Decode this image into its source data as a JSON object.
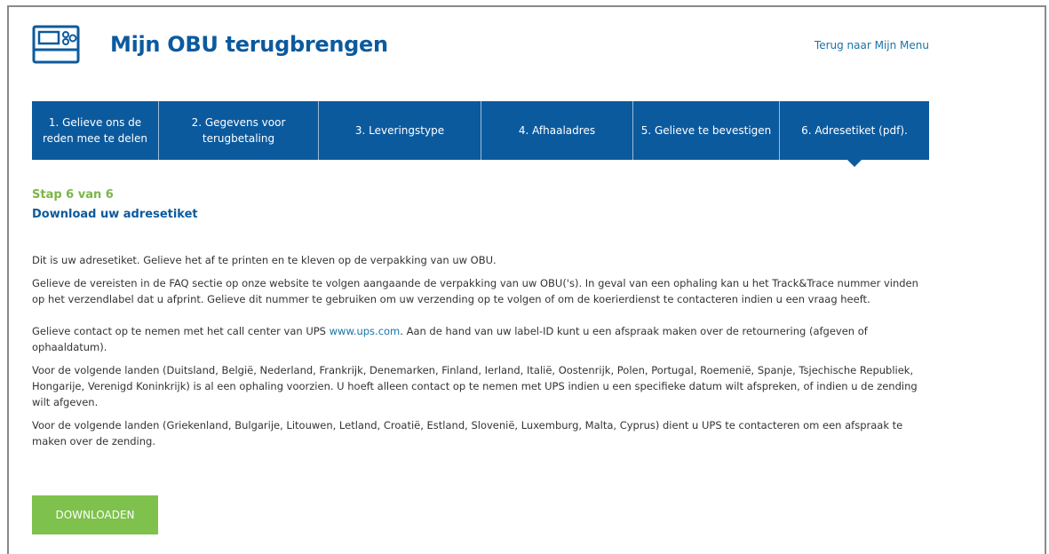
{
  "colors": {
    "brand_blue": "#0c5a9e",
    "link_blue": "#1a73a8",
    "accent_green": "#7ec14c",
    "step_green": "#7ab648"
  },
  "header": {
    "icon": "obu-device-icon",
    "title": "Mijn OBU terugbrengen",
    "back_link": "Terug naar Mijn Menu"
  },
  "steps": [
    {
      "label": "1. Gelieve ons de reden mee te delen",
      "active": false
    },
    {
      "label": "2. Gegevens voor terugbetaling",
      "active": false
    },
    {
      "label": "3. Leveringstype",
      "active": false
    },
    {
      "label": "4. Afhaaladres",
      "active": false
    },
    {
      "label": "5. Gelieve te bevestigen",
      "active": false
    },
    {
      "label": "6. Adresetiket (pdf).",
      "active": true
    }
  ],
  "main": {
    "step_count": "Stap 6 van 6",
    "section_title": "Download uw adresetiket",
    "paragraph1": "Dit is uw adresetiket. Gelieve het af te printen en te kleven op de verpakking van uw OBU.",
    "paragraph2": "Gelieve de vereisten in de FAQ sectie op onze website te volgen aangaande de verpakking van uw OBU('s). In geval van een ophaling kan u het Track&Trace nummer vinden op het verzendlabel dat u afprint. Gelieve dit nummer te gebruiken om uw verzending op te volgen of om de koerierdienst te contacteren indien u een vraag heeft.",
    "paragraph3_before": "Gelieve contact op te nemen met het call center van UPS ",
    "paragraph3_link": "www.ups.com",
    "paragraph3_after": ". Aan de hand van uw label-ID kunt u een afspraak maken over de retournering (afgeven of ophaaldatum).",
    "paragraph4": "Voor de volgende landen (Duitsland, België, Nederland, Frankrijk, Denemarken, Finland, Ierland, Italië, Oostenrijk, Polen, Portugal, Roemenië, Spanje, Tsjechische Republiek, Hongarije, Verenigd Koninkrijk) is al een ophaling voorzien. U hoeft alleen contact op te nemen met UPS indien u een specifieke datum wilt afspreken, of indien u de zending wilt afgeven.",
    "paragraph5": "Voor de volgende landen (Griekenland, Bulgarije, Litouwen, Letland, Croatië, Estland, Slovenië, Luxemburg, Malta, Cyprus) dient u UPS te contacteren om een afspraak te maken over de zending.",
    "download_label": "DOWNLOADEN"
  }
}
